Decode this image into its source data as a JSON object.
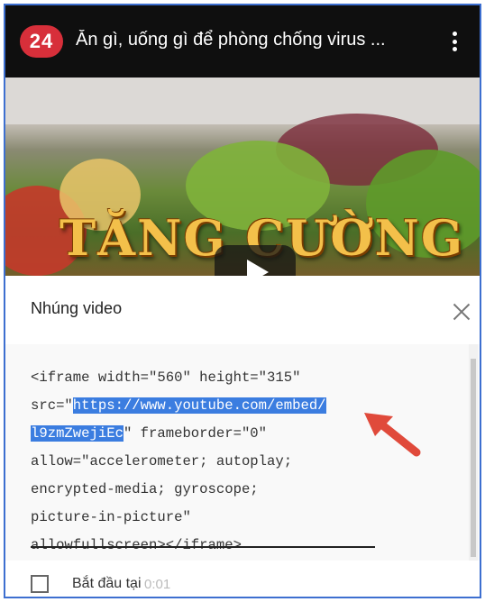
{
  "header": {
    "logo": "24",
    "title": "Ăn gì, uống gì để phòng chống virus ..."
  },
  "video": {
    "overlay_title": "TĂNG CƯỜNG"
  },
  "dialog": {
    "title": "Nhúng video",
    "code_lines": [
      {
        "pre": "<iframe width=\"560\" height=\"315\"",
        "hl": "",
        "post": ""
      },
      {
        "pre": "src=\"",
        "hl": "https://www.youtube.com/embed/",
        "post": ""
      },
      {
        "pre": "",
        "hl": "l9zmZwejiEc",
        "post": "\" frameborder=\"0\""
      },
      {
        "pre": "allow=\"accelerometer; autoplay;",
        "hl": "",
        "post": ""
      },
      {
        "pre": "encrypted-media; gyroscope;",
        "hl": "",
        "post": ""
      },
      {
        "pre": "picture-in-picture\"",
        "hl": "",
        "post": ""
      },
      {
        "pre": "allowfullscreen></iframe>",
        "hl": "",
        "post": ""
      }
    ],
    "start_at_label": "Bắt đầu tại",
    "start_at_time": "0:01"
  },
  "colors": {
    "highlight": "#3b7de0",
    "arrow": "#e04a3b",
    "logo": "#d72f3a"
  }
}
